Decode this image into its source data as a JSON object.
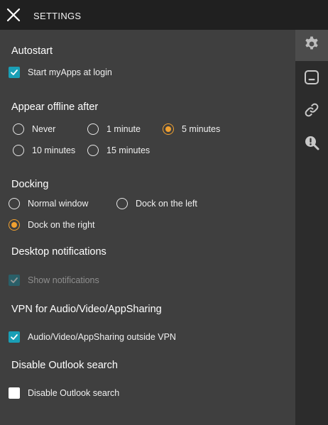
{
  "window": {
    "title": "SETTINGS"
  },
  "rail": {
    "items": [
      {
        "icon": "gear-icon",
        "active": true
      },
      {
        "icon": "chat-window-icon",
        "active": false
      },
      {
        "icon": "link-icon",
        "active": false
      },
      {
        "icon": "search-info-icon",
        "active": false
      }
    ]
  },
  "autostart": {
    "heading": "Autostart",
    "start_label": "Start myApps at login",
    "start_checked": true
  },
  "offline": {
    "heading": "Appear offline after",
    "options": [
      {
        "label": "Never",
        "selected": false
      },
      {
        "label": "1 minute",
        "selected": false
      },
      {
        "label": "5 minutes",
        "selected": true
      },
      {
        "label": "10 minutes",
        "selected": false
      },
      {
        "label": "15 minutes",
        "selected": false
      }
    ]
  },
  "docking": {
    "heading": "Docking",
    "options": [
      {
        "label": "Normal window",
        "selected": false
      },
      {
        "label": "Dock on the left",
        "selected": false
      },
      {
        "label": "Dock on the right",
        "selected": true
      }
    ]
  },
  "notifications": {
    "heading": "Desktop notifications",
    "show_label": "Show notifications",
    "show_checked": true,
    "show_disabled": true
  },
  "vpn": {
    "heading": "VPN for Audio/Video/AppSharing",
    "outside_label": "Audio/Video/AppSharing outside VPN",
    "outside_checked": true
  },
  "outlook": {
    "heading": "Disable Outlook search",
    "disable_label": "Disable Outlook search",
    "disable_checked": false
  },
  "colors": {
    "accent_check": "#1a9fb6",
    "accent_radio": "#f0a030",
    "titlebar": "#202020",
    "panel": "#3f3f3f",
    "rail": "#2c2c2c"
  }
}
